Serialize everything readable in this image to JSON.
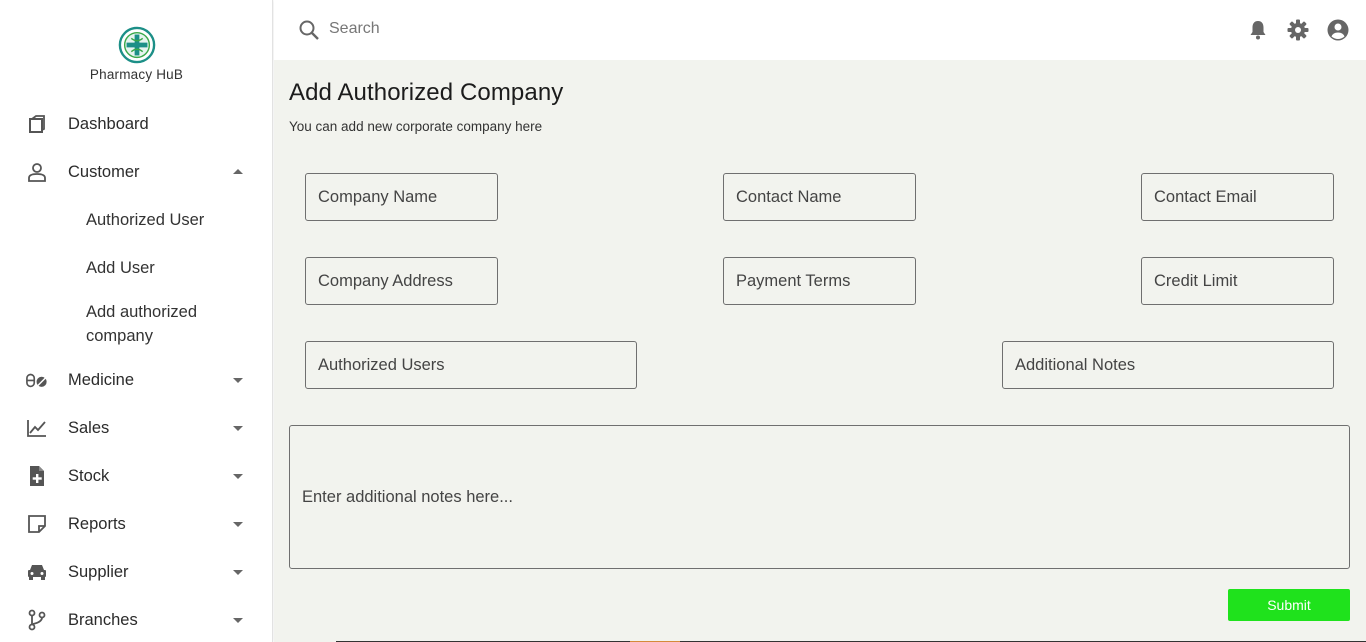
{
  "brand": {
    "name": "Pharmacy HuB"
  },
  "search": {
    "placeholder": "Search"
  },
  "sidebar": {
    "items": [
      {
        "label": "Dashboard",
        "icon": "dashboard-icon"
      },
      {
        "label": "Customer",
        "icon": "person-icon",
        "expanded": true
      },
      {
        "label": "Medicine",
        "icon": "pill-icon"
      },
      {
        "label": "Sales",
        "icon": "chart-line-icon"
      },
      {
        "label": "Stock",
        "icon": "file-plus-icon"
      },
      {
        "label": "Reports",
        "icon": "note-icon"
      },
      {
        "label": "Supplier",
        "icon": "car-icon"
      },
      {
        "label": "Branches",
        "icon": "branch-icon"
      }
    ],
    "customer_sub": [
      {
        "label": "Authorized User"
      },
      {
        "label": "Add User"
      },
      {
        "label": "Add authorized company"
      }
    ]
  },
  "page": {
    "title": "Add Authorized Company",
    "subtitle": "You can add new corporate company here"
  },
  "form": {
    "company_name": "Company Name",
    "contact_name": "Contact Name",
    "contact_email": "Contact Email",
    "company_address": "Company Address",
    "payment_terms": "Payment Terms",
    "credit_limit": "Credit Limit",
    "authorized_users": "Authorized Users",
    "additional_notes": "Additional Notes",
    "notes_placeholder": "Enter additional notes here...",
    "submit_label": "Submit"
  },
  "colors": {
    "submit": "#1fe21c",
    "main_bg": "#f2f3ee",
    "logo_teal": "#1c8f87",
    "logo_green": "#3aa84a"
  }
}
